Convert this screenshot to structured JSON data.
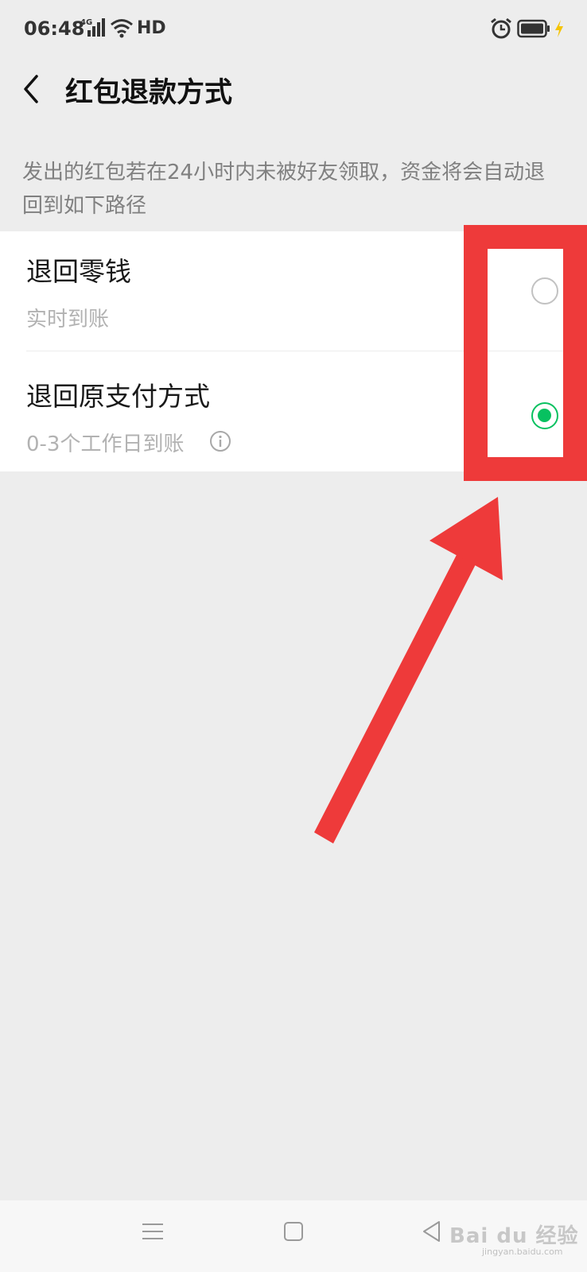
{
  "status_bar": {
    "time": "06:48",
    "network": "4G",
    "hd": "HD",
    "icons": [
      "signal-icon",
      "wifi-icon",
      "alarm-icon",
      "battery-icon",
      "charging-icon"
    ]
  },
  "nav": {
    "title": "红包退款方式",
    "back_icon": "back-arrow-icon"
  },
  "description": "发出的红包若在24小时内未被好友领取，资金将会自动退回到如下路径",
  "options": [
    {
      "title": "退回零钱",
      "subtitle": "实时到账",
      "selected": false
    },
    {
      "title": "退回原支付方式",
      "subtitle": "0-3个工作日到账",
      "selected": true,
      "has_info_icon": true
    }
  ],
  "annotation": {
    "color": "#ee3a3a",
    "shapes": [
      "highlight-box",
      "arrow"
    ]
  },
  "bottom_nav": {
    "icons": [
      "menu-icon",
      "home-icon",
      "back-icon"
    ],
    "watermark": "Bai du 经验",
    "watermark_sub": "jingyan.baidu.com"
  },
  "colors": {
    "accent": "#07c160",
    "background": "#ededed",
    "panel": "#ffffff"
  }
}
